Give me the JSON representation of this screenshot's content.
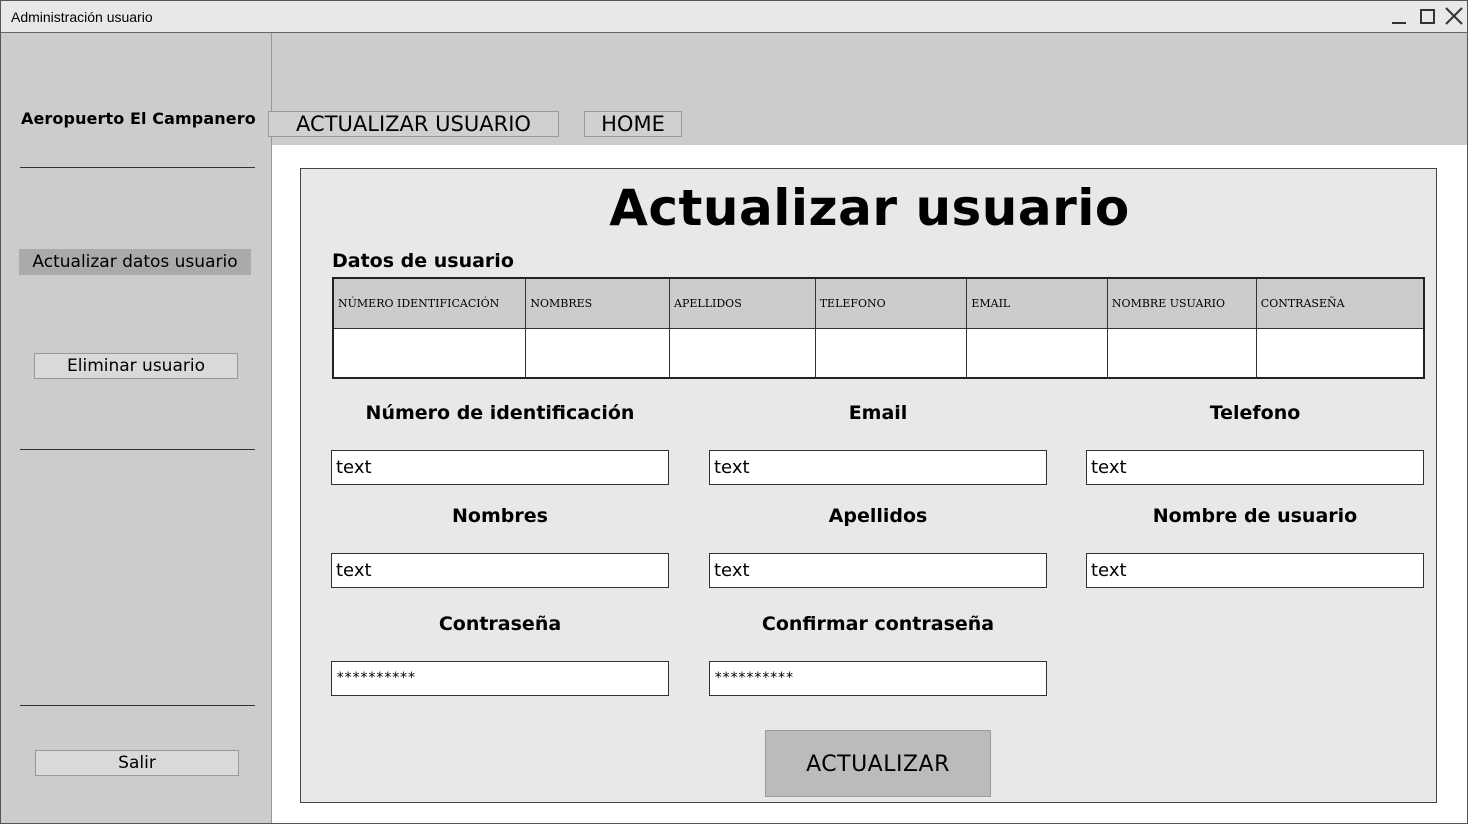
{
  "window": {
    "title": "Administración usuario",
    "controls": [
      "minimize-icon",
      "maximize-icon",
      "close-icon"
    ]
  },
  "sidebar": {
    "brand": "Aeropuerto El Campanero",
    "items": [
      {
        "label": "Actualizar datos usuario",
        "active": true
      },
      {
        "label": "Eliminar usuario",
        "active": false
      }
    ],
    "exit_label": "Salir"
  },
  "topnav": {
    "tabs": [
      {
        "label": "ACTUALIZAR USUARIO"
      },
      {
        "label": "HOME"
      }
    ]
  },
  "main": {
    "title": "Actualizar usuario",
    "table_label": "Datos de usuario",
    "table": {
      "columns": [
        "NÚMERO IDENTIFICACIÓN",
        "NOMBRES",
        "APELLIDOS",
        "TELEFONO",
        "EMAIL",
        "NOMBRE USUARIO",
        "CONTRASEÑA"
      ],
      "rows": [
        [
          "",
          "",
          "",
          "",
          "",
          "",
          ""
        ]
      ]
    },
    "fields": [
      {
        "label": "Número de identificación",
        "value": "text"
      },
      {
        "label": "Email",
        "value": "text"
      },
      {
        "label": "Telefono",
        "value": "text"
      },
      {
        "label": "Nombres",
        "value": "text"
      },
      {
        "label": "Apellidos",
        "value": "text"
      },
      {
        "label": "Nombre de usuario",
        "value": "text"
      },
      {
        "label": "Contraseña",
        "value": "**********"
      },
      {
        "label": "Confirmar contraseña",
        "value": "**********"
      }
    ],
    "submit_label": "ACTUALIZAR"
  },
  "colors": {
    "sidebar_bg": "#cccccc",
    "panel_bg": "#e8e8e8",
    "active_item_bg": "#aaaaaa",
    "button_bg": "#bbbbbb"
  }
}
